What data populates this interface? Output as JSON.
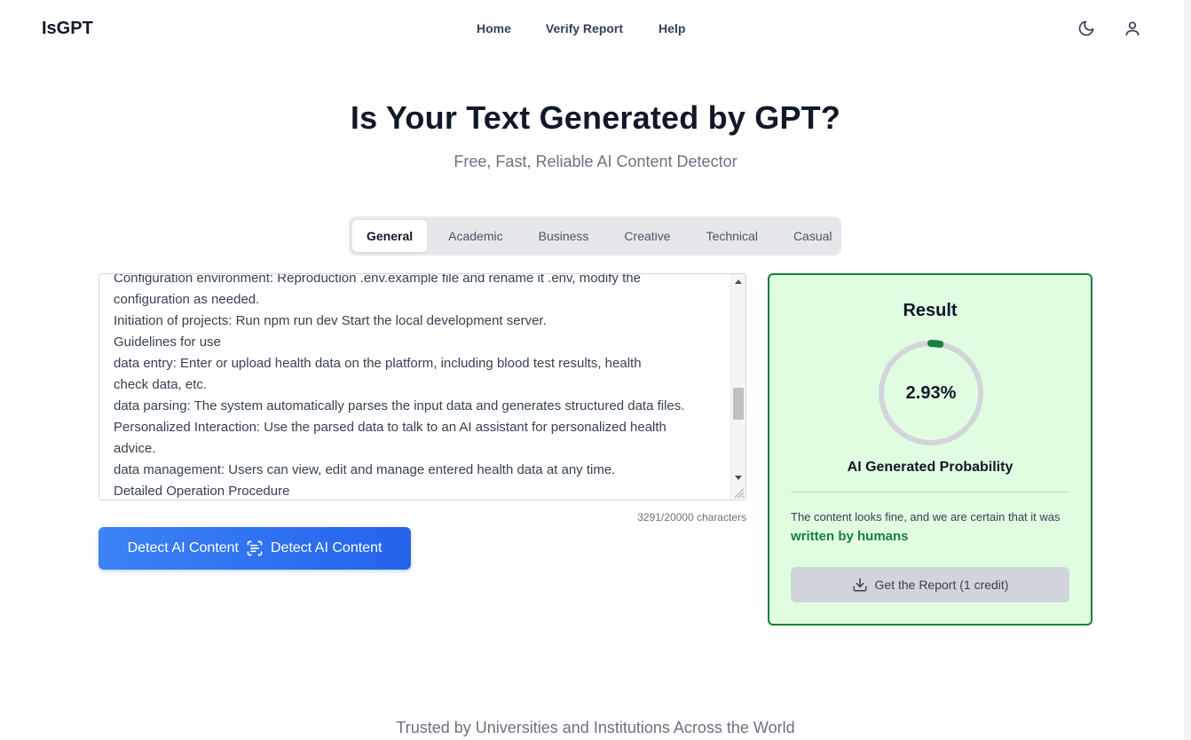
{
  "header": {
    "logo": "IsGPT",
    "nav": [
      "Home",
      "Verify Report",
      "Help"
    ]
  },
  "hero": {
    "title": "Is Your Text Generated by GPT?",
    "subtitle": "Free, Fast, Reliable AI Content Detector"
  },
  "tabs": [
    "General",
    "Academic",
    "Business",
    "Creative",
    "Technical",
    "Casual"
  ],
  "active_tab": "General",
  "editor": {
    "lines": [
      "Configuration environment: Reproduction .env.example file and rename it .env, modify the",
      "configuration as needed.",
      "Initiation of projects: Run npm run dev Start the local development server.",
      "Guidelines for use",
      "data entry: Enter or upload health data on the platform, including blood test results, health",
      "check data, etc.",
      "data parsing: The system automatically parses the input data and generates structured data files.",
      "Personalized Interaction: Use the parsed data to talk to an AI assistant for personalized health",
      "advice.",
      "data management: Users can view, edit and manage entered health data at any time.",
      "Detailed Operation Procedure"
    ],
    "char_count": "3291/20000 characters"
  },
  "detect_button": {
    "label_left": "Detect AI Content",
    "label_right": "Detect AI Content"
  },
  "result": {
    "title": "Result",
    "probability": "2.93%",
    "probability_fraction": 0.0293,
    "probability_label": "AI Generated Probability",
    "verdict_prefix": "The content looks fine, and we are certain that it was ",
    "verdict_highlight": "written by humans",
    "report_button": "Get the Report (1 credit)"
  },
  "footer": {
    "trusted": "Trusted by Universities and Institutions Across the World"
  },
  "colors": {
    "accent": "#2563eb",
    "result_bg": "#e1fde1",
    "result_border": "#15803d",
    "human_green": "#15803d",
    "gauge_track": "#d1d5db",
    "gauge_fill": "#15803d"
  },
  "icons": {
    "theme_toggle": "moon-icon",
    "account": "user-icon",
    "scan": "scan-text-icon",
    "download": "download-icon"
  }
}
